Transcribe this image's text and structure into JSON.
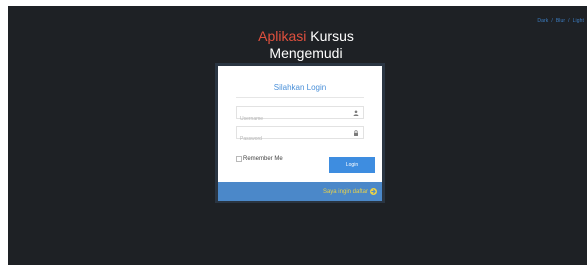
{
  "theme_switch": {
    "options": [
      "Dark",
      "Blur",
      "Light"
    ],
    "separator": "/"
  },
  "app_title": {
    "accent": "Aplikasi",
    "line1_rest": "Kursus",
    "line2": "Mengemudi"
  },
  "login": {
    "heading": "Silahkan Login",
    "username_placeholder": "Username",
    "password_placeholder": "Password",
    "remember_label": "Remember Me",
    "submit_label": "Login",
    "register_link": "Saya ingin daftar"
  },
  "icons": {
    "username": "user-icon",
    "password": "lock-icon",
    "register": "arrow-right-icon"
  },
  "colors": {
    "background": "#1e2125",
    "accent_red": "#e0503e",
    "heading_blue": "#4a90d9",
    "button_blue": "#3e8de0",
    "footer_blue": "#4b88c9",
    "link_yellow": "#e8d24a"
  }
}
